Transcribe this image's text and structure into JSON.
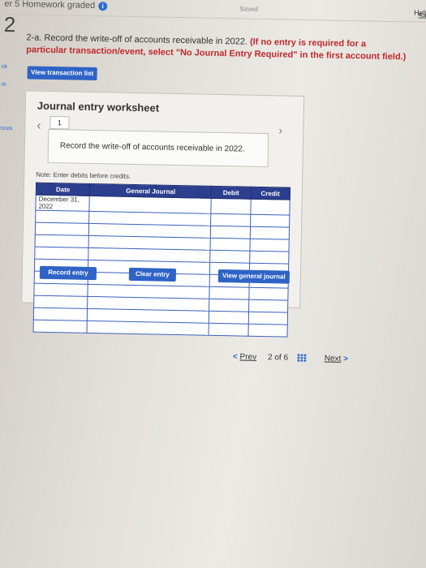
{
  "header": {
    "title": "er 5 Homework graded",
    "saved": "Saved",
    "help": "Help",
    "side": "Sa"
  },
  "question": {
    "number": "2",
    "prompt_lead": "2-a. Record the write-off of accounts receivable in 2022.",
    "prompt_red": "(If no entry is required for a particular transaction/event, select \"No Journal Entry Required\" in the first account field.)"
  },
  "left_tabs": [
    "ok",
    "nt",
    "nces"
  ],
  "buttons": {
    "view_transactions": "View transaction list",
    "record": "Record entry",
    "clear": "Clear entry",
    "view_journal": "View general journal"
  },
  "worksheet": {
    "title": "Journal entry worksheet",
    "page": "1",
    "instruction": "Record the write-off of accounts receivable in 2022.",
    "note": "Note: Enter debits before credits.",
    "columns": [
      "Date",
      "General Journal",
      "Debit",
      "Credit"
    ],
    "rows": [
      {
        "date": "December 31, 2022",
        "account": "",
        "debit": "",
        "credit": ""
      },
      {
        "date": "",
        "account": "",
        "debit": "",
        "credit": ""
      },
      {
        "date": "",
        "account": "",
        "debit": "",
        "credit": ""
      },
      {
        "date": "",
        "account": "",
        "debit": "",
        "credit": ""
      },
      {
        "date": "",
        "account": "",
        "debit": "",
        "credit": ""
      },
      {
        "date": "",
        "account": "",
        "debit": "",
        "credit": ""
      },
      {
        "date": "",
        "account": "",
        "debit": "",
        "credit": ""
      },
      {
        "date": "",
        "account": "",
        "debit": "",
        "credit": ""
      },
      {
        "date": "",
        "account": "",
        "debit": "",
        "credit": ""
      },
      {
        "date": "",
        "account": "",
        "debit": "",
        "credit": ""
      },
      {
        "date": "",
        "account": "",
        "debit": "",
        "credit": ""
      }
    ]
  },
  "pagination": {
    "prev": "Prev",
    "current": "2",
    "of_label": "of",
    "total": "6",
    "next": "Next"
  }
}
